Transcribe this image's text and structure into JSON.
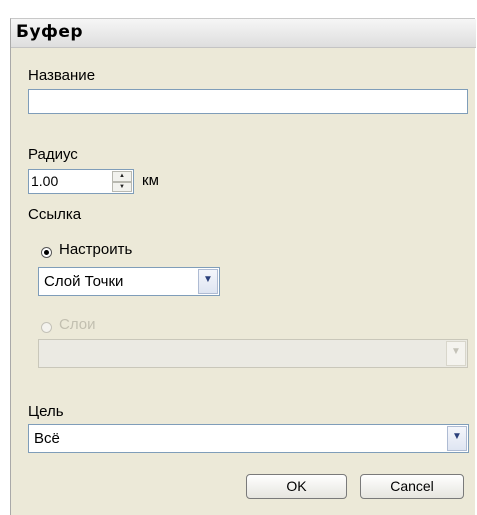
{
  "dialog": {
    "title": "Буфер",
    "name": {
      "label": "Название",
      "value": ""
    },
    "radius": {
      "label": "Радиус",
      "value": "1.00",
      "unit": "км"
    },
    "reference": {
      "label": "Ссылка",
      "option_custom": {
        "label": "Настроить",
        "checked": true
      },
      "layer_select": {
        "value": "Слой Точки"
      },
      "option_layers": {
        "label": "Слои",
        "checked": false,
        "enabled": false
      },
      "layers_select": {
        "value": ""
      }
    },
    "target": {
      "label": "Цель",
      "value": "Всё"
    },
    "buttons": {
      "ok": "OK",
      "cancel": "Cancel"
    }
  }
}
